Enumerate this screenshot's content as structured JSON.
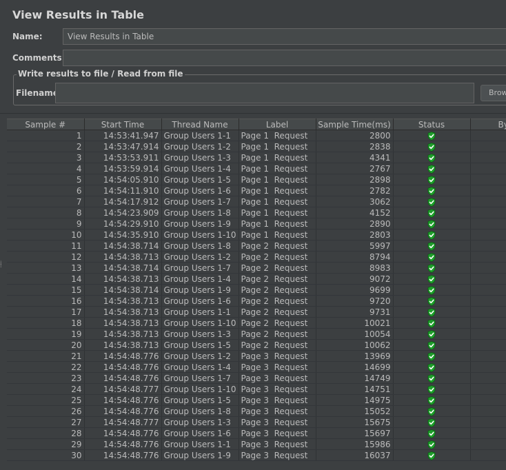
{
  "title": "View Results in Table",
  "name_field": {
    "label": "Name:",
    "value": "View Results in Table"
  },
  "comments_field": {
    "label": "Comments:",
    "value": ""
  },
  "file_panel": {
    "legend": "Write results to file / Read from file",
    "filename_label": "Filename",
    "filename_value": "",
    "browse_label": "Browse..."
  },
  "table": {
    "columns": [
      "Sample #",
      "Start Time",
      "Thread Name",
      "Label",
      "Sample Time(ms)",
      "Status",
      "Bytes"
    ],
    "rows": [
      {
        "sample": "1",
        "start": "14:53:41.947",
        "thread": "Group Users 1-1",
        "label": "Page 1  Request",
        "time": "2800",
        "status": "success"
      },
      {
        "sample": "2",
        "start": "14:53:47.914",
        "thread": "Group Users 1-2",
        "label": "Page 1  Request",
        "time": "2838",
        "status": "success"
      },
      {
        "sample": "3",
        "start": "14:53:53.911",
        "thread": "Group Users 1-3",
        "label": "Page 1  Request",
        "time": "4341",
        "status": "success"
      },
      {
        "sample": "4",
        "start": "14:53:59.914",
        "thread": "Group Users 1-4",
        "label": "Page 1  Request",
        "time": "2767",
        "status": "success"
      },
      {
        "sample": "5",
        "start": "14:54:05.910",
        "thread": "Group Users 1-5",
        "label": "Page 1  Request",
        "time": "2898",
        "status": "success"
      },
      {
        "sample": "6",
        "start": "14:54:11.910",
        "thread": "Group Users 1-6",
        "label": "Page 1  Request",
        "time": "2782",
        "status": "success"
      },
      {
        "sample": "7",
        "start": "14:54:17.912",
        "thread": "Group Users 1-7",
        "label": "Page 1  Request",
        "time": "3062",
        "status": "success"
      },
      {
        "sample": "8",
        "start": "14:54:23.909",
        "thread": "Group Users 1-8",
        "label": "Page 1  Request",
        "time": "4152",
        "status": "success"
      },
      {
        "sample": "9",
        "start": "14:54:29.910",
        "thread": "Group Users 1-9",
        "label": "Page 1  Request",
        "time": "2890",
        "status": "success"
      },
      {
        "sample": "10",
        "start": "14:54:35.910",
        "thread": "Group Users 1-10",
        "label": "Page 1  Request",
        "time": "2803",
        "status": "success"
      },
      {
        "sample": "11",
        "start": "14:54:38.714",
        "thread": "Group Users 1-8",
        "label": "Page 2  Request",
        "time": "5997",
        "status": "success"
      },
      {
        "sample": "12",
        "start": "14:54:38.713",
        "thread": "Group Users 1-2",
        "label": "Page 2  Request",
        "time": "8794",
        "status": "success"
      },
      {
        "sample": "13",
        "start": "14:54:38.714",
        "thread": "Group Users 1-7",
        "label": "Page 2  Request",
        "time": "8983",
        "status": "success"
      },
      {
        "sample": "14",
        "start": "14:54:38.713",
        "thread": "Group Users 1-4",
        "label": "Page 2  Request",
        "time": "9072",
        "status": "success"
      },
      {
        "sample": "15",
        "start": "14:54:38.714",
        "thread": "Group Users 1-9",
        "label": "Page 2  Request",
        "time": "9699",
        "status": "success"
      },
      {
        "sample": "16",
        "start": "14:54:38.713",
        "thread": "Group Users 1-6",
        "label": "Page 2  Request",
        "time": "9720",
        "status": "success"
      },
      {
        "sample": "17",
        "start": "14:54:38.713",
        "thread": "Group Users 1-1",
        "label": "Page 2  Request",
        "time": "9731",
        "status": "success"
      },
      {
        "sample": "18",
        "start": "14:54:38.713",
        "thread": "Group Users 1-10",
        "label": "Page 2  Request",
        "time": "10021",
        "status": "success"
      },
      {
        "sample": "19",
        "start": "14:54:38.713",
        "thread": "Group Users 1-3",
        "label": "Page 2  Request",
        "time": "10054",
        "status": "success"
      },
      {
        "sample": "20",
        "start": "14:54:38.713",
        "thread": "Group Users 1-5",
        "label": "Page 2  Request",
        "time": "10062",
        "status": "success"
      },
      {
        "sample": "21",
        "start": "14:54:48.776",
        "thread": "Group Users 1-2",
        "label": "Page 3  Request",
        "time": "13969",
        "status": "success"
      },
      {
        "sample": "22",
        "start": "14:54:48.776",
        "thread": "Group Users 1-4",
        "label": "Page 3  Request",
        "time": "14699",
        "status": "success"
      },
      {
        "sample": "23",
        "start": "14:54:48.776",
        "thread": "Group Users 1-7",
        "label": "Page 3  Request",
        "time": "14749",
        "status": "success"
      },
      {
        "sample": "24",
        "start": "14:54:48.777",
        "thread": "Group Users 1-10",
        "label": "Page 3  Request",
        "time": "14751",
        "status": "success"
      },
      {
        "sample": "25",
        "start": "14:54:48.776",
        "thread": "Group Users 1-5",
        "label": "Page 3  Request",
        "time": "14975",
        "status": "success"
      },
      {
        "sample": "26",
        "start": "14:54:48.776",
        "thread": "Group Users 1-8",
        "label": "Page 3  Request",
        "time": "15052",
        "status": "success"
      },
      {
        "sample": "27",
        "start": "14:54:48.777",
        "thread": "Group Users 1-3",
        "label": "Page 3  Request",
        "time": "15675",
        "status": "success"
      },
      {
        "sample": "28",
        "start": "14:54:48.776",
        "thread": "Group Users 1-6",
        "label": "Page 3  Request",
        "time": "15697",
        "status": "success"
      },
      {
        "sample": "29",
        "start": "14:54:48.776",
        "thread": "Group Users 1-1",
        "label": "Page 3  Request",
        "time": "15986",
        "status": "success"
      },
      {
        "sample": "30",
        "start": "14:54:48.776",
        "thread": "Group Users 1-9",
        "label": "Page 3  Request",
        "time": "16037",
        "status": "success"
      }
    ]
  },
  "status_icon": "shield-check-icon",
  "colors": {
    "background": "#3c3f41",
    "success": "#2fbf2f"
  }
}
